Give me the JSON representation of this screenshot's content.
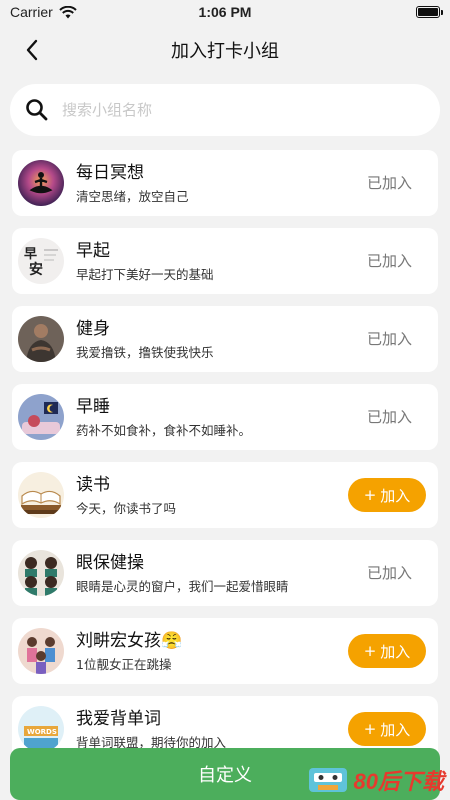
{
  "status": {
    "carrier": "Carrier",
    "time": "1:06 PM"
  },
  "nav": {
    "title": "加入打卡小组"
  },
  "search": {
    "placeholder": "搜索小组名称",
    "value": ""
  },
  "groups": [
    {
      "name": "每日冥想",
      "desc": "清空思绪，放空自己",
      "joined": true,
      "avatar": "meditation-avatar"
    },
    {
      "name": "早起",
      "desc": "早起打下美好一天的基础",
      "joined": true,
      "avatar": "calligraphy-avatar"
    },
    {
      "name": "健身",
      "desc": "我爱撸铁，撸铁使我快乐",
      "joined": true,
      "avatar": "fitness-avatar"
    },
    {
      "name": "早睡",
      "desc": "药补不如食补，食补不如睡补。",
      "joined": true,
      "avatar": "sleep-avatar"
    },
    {
      "name": "读书",
      "desc": "今天，你读书了吗",
      "joined": false,
      "avatar": "book-avatar"
    },
    {
      "name": "眼保健操",
      "desc": "眼睛是心灵的窗户，我们一起爱惜眼睛",
      "joined": true,
      "avatar": "eye-exercise-avatar"
    },
    {
      "name": "刘畊宏女孩😤",
      "desc": "1位靓女正在跳操",
      "joined": false,
      "avatar": "dance-avatar"
    },
    {
      "name": "我爱背单词",
      "desc": "背单词联盟，期待你的加入",
      "joined": false,
      "avatar": "words-avatar"
    }
  ],
  "labels": {
    "joined": "已加入",
    "join": "加入",
    "join_plus": "+",
    "calligraphy_1": "早",
    "calligraphy_2": "安",
    "words_tag": "WORDS"
  },
  "footer": {
    "custom_button": "自定义"
  },
  "watermark": {
    "text": "80后下载"
  },
  "colors": {
    "accent": "#f5a200",
    "primary_green": "#4cae5c",
    "background": "#f2f2f2"
  }
}
